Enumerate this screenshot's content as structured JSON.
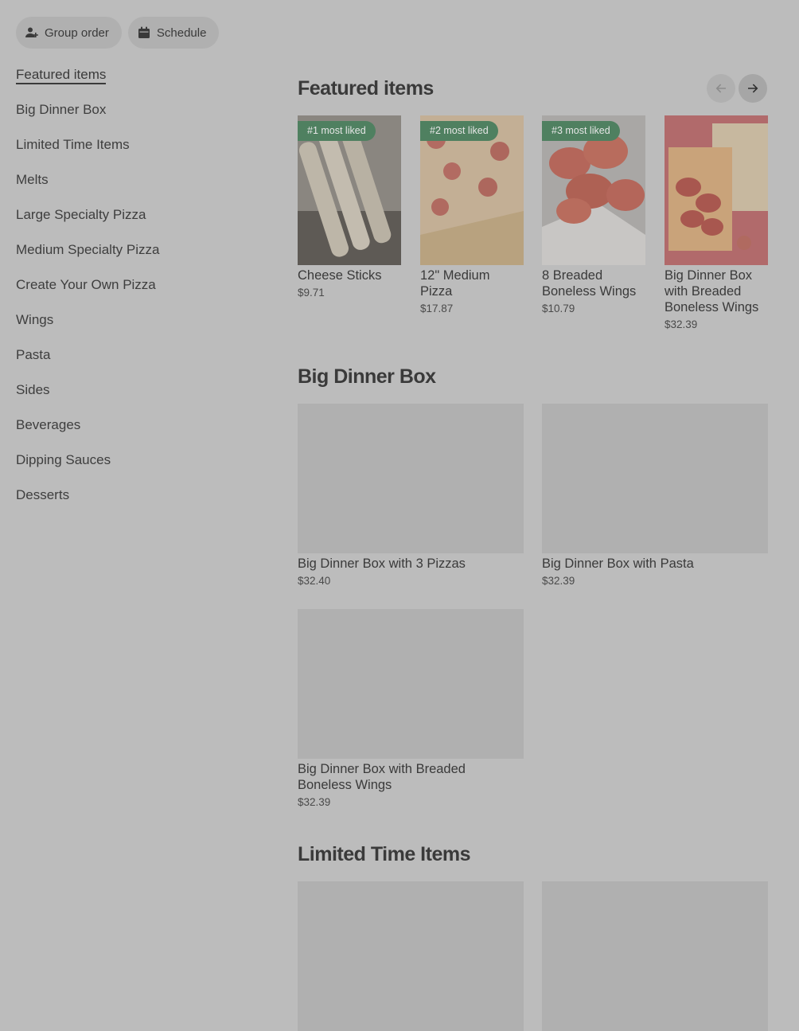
{
  "top_actions": {
    "group_order": "Group order",
    "schedule": "Schedule"
  },
  "sidebar": {
    "items": [
      {
        "label": "Featured items",
        "active": true
      },
      {
        "label": "Big Dinner Box"
      },
      {
        "label": "Limited Time Items"
      },
      {
        "label": "Melts"
      },
      {
        "label": "Large Specialty Pizza"
      },
      {
        "label": "Medium Specialty Pizza"
      },
      {
        "label": "Create Your Own Pizza"
      },
      {
        "label": "Wings"
      },
      {
        "label": "Pasta"
      },
      {
        "label": "Sides"
      },
      {
        "label": "Beverages"
      },
      {
        "label": "Dipping Sauces"
      },
      {
        "label": "Desserts"
      }
    ]
  },
  "featured": {
    "title": "Featured items",
    "items": [
      {
        "badge": "#1 most liked",
        "name": "Cheese Sticks",
        "price": "$9.71"
      },
      {
        "badge": "#2 most liked",
        "name": "12\" Medium Pizza",
        "price": "$17.87"
      },
      {
        "badge": "#3 most liked",
        "name": "8 Breaded Boneless Wings",
        "price": "$10.79"
      },
      {
        "badge": "",
        "name": "Big Dinner Box with Breaded Boneless Wings",
        "price": "$32.39"
      }
    ]
  },
  "big_dinner_box": {
    "title": "Big Dinner Box",
    "items": [
      {
        "name": "Big Dinner Box with 3 Pizzas",
        "price": "$32.40"
      },
      {
        "name": "Big Dinner Box with Pasta",
        "price": "$32.39"
      },
      {
        "name": "Big Dinner Box with Breaded Boneless Wings",
        "price": "$32.39"
      }
    ]
  },
  "limited_time": {
    "title": "Limited Time Items"
  },
  "colors": {
    "background": "#bcbcbc",
    "placeholder": "#b0b0b0",
    "badge": "#4f8060"
  }
}
